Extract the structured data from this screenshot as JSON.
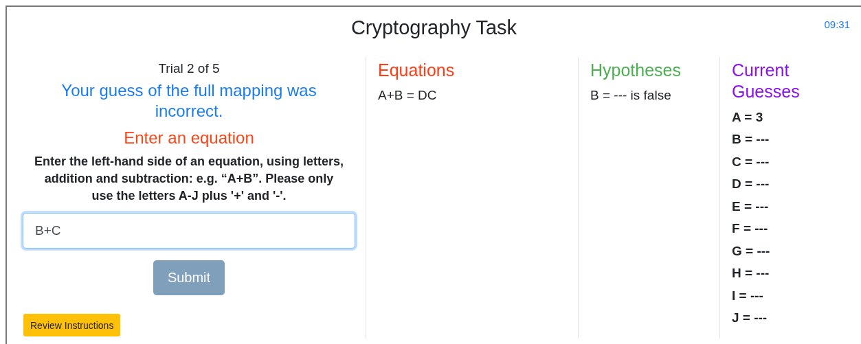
{
  "window": {
    "title": "Cryptography Task",
    "timer": "09:31"
  },
  "trial_panel": {
    "trial": "Trial 2 of 5",
    "feedback": "Your guess of the full mapping was incorrect.",
    "heading": "Enter an equation",
    "instructions": "Enter the left-hand side of an equation, using letters, addition and subtraction: e.g. “A+B”. Please only use the letters A-J plus '+' and '-'.",
    "equation_input": {
      "value": "B+C",
      "focused": true
    },
    "submit_button": {
      "label": "Submit",
      "disabled": true
    },
    "review_button": {
      "label": "Review Instructions"
    }
  },
  "columns": [
    {
      "title": "Equations",
      "color": "#ff3c14",
      "bold_items": false,
      "items": [
        "A+B = DC"
      ]
    },
    {
      "title": "Hypotheses",
      "color": "#4caf50",
      "bold_items": false,
      "items": [
        "B = --- is false"
      ]
    },
    {
      "title": "Current Guesses",
      "color": "#8a10f0",
      "bold_items": true,
      "items": [
        "A = 3",
        "B = ---",
        "C = ---",
        "D = ---",
        "E = ---",
        "F = ---",
        "G = ---",
        "H = ---",
        "I = ---",
        "J = ---"
      ]
    }
  ]
}
